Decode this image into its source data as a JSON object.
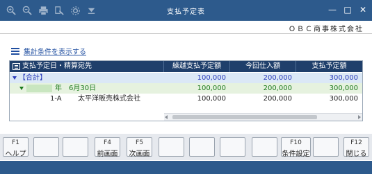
{
  "window": {
    "title": "支払予定表",
    "toolbar_icons": [
      "search-plus-icon",
      "search-minus-icon",
      "print-icon",
      "printer-settings-icon",
      "settings-icon",
      "filter-icon"
    ]
  },
  "company": "ＯＢＣ商事株式会社",
  "link": {
    "label": "集計条件を表示する"
  },
  "table": {
    "headers": [
      "支払予定日・精算宛先",
      "繰越支払予定額",
      "今回仕入額",
      "支払予定額"
    ],
    "rows": [
      {
        "label": "【合計】",
        "values": [
          "100,000",
          "200,000",
          "300,000"
        ]
      },
      {
        "year_suffix": "年",
        "date": "6月30日",
        "values": [
          "100,000",
          "200,000",
          "300,000"
        ]
      },
      {
        "code": "1-A",
        "name": "太平洋販売株式会社",
        "values": [
          "100,000",
          "200,000",
          "300,000"
        ]
      }
    ]
  },
  "fkeys": [
    {
      "num": "F1",
      "label": "ヘルプ"
    },
    {
      "num": "",
      "label": ""
    },
    {
      "num": "",
      "label": ""
    },
    {
      "num": "F4",
      "label": "前画面"
    },
    {
      "num": "F5",
      "label": "次画面"
    },
    {
      "num": "",
      "label": ""
    },
    {
      "num": "",
      "label": ""
    },
    {
      "num": "",
      "label": ""
    },
    {
      "num": "",
      "label": ""
    },
    {
      "num": "F10",
      "label": "条件設定"
    },
    {
      "num": "",
      "label": ""
    },
    {
      "num": "F12",
      "label": "閉じる"
    }
  ]
}
